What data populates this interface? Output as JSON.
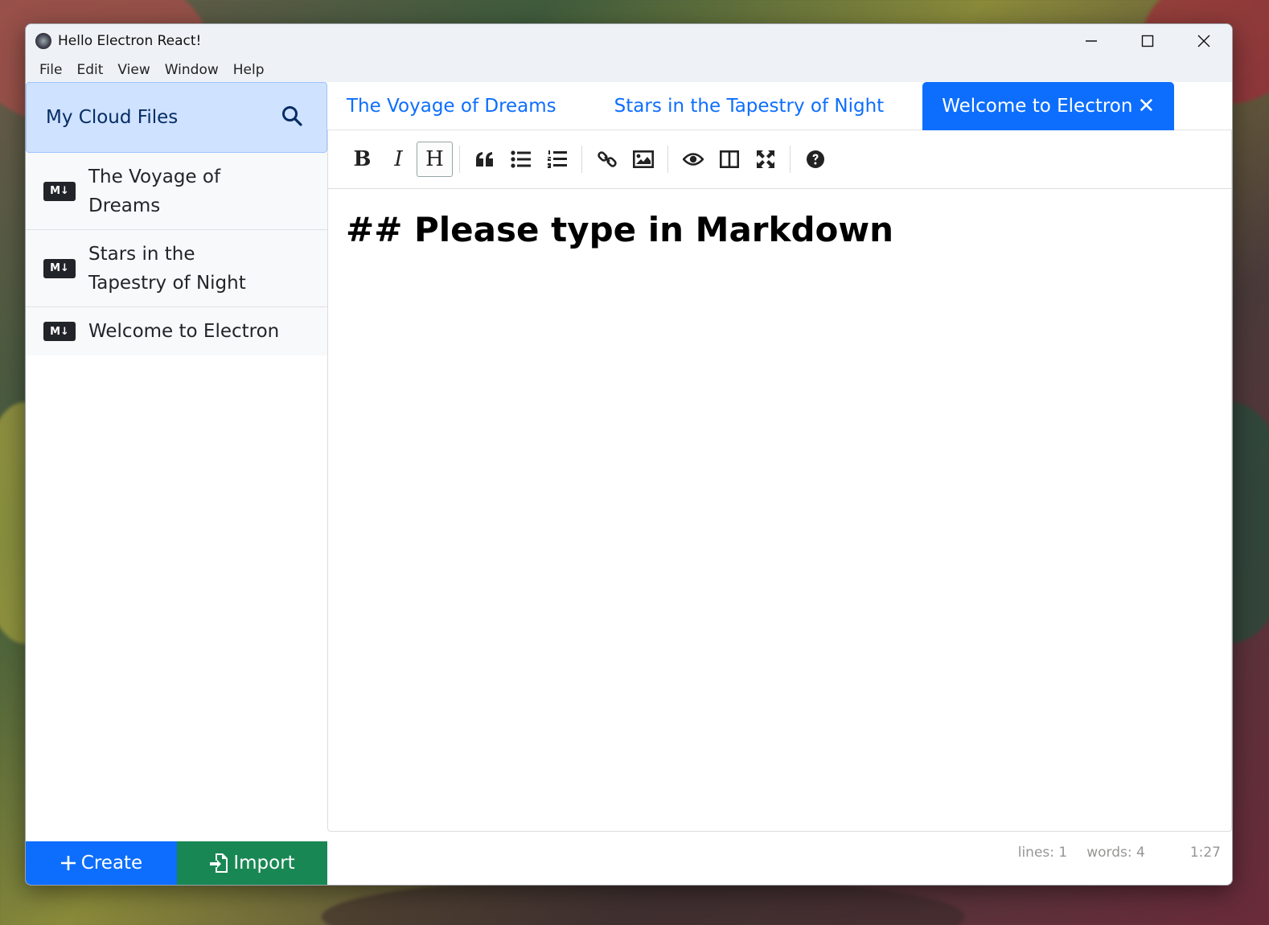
{
  "window": {
    "title": "Hello Electron React!"
  },
  "menu": [
    {
      "label": "File"
    },
    {
      "label": "Edit"
    },
    {
      "label": "View"
    },
    {
      "label": "Window"
    },
    {
      "label": "Help"
    }
  ],
  "sidebar": {
    "title": "My Cloud Files",
    "search_icon": "search-icon",
    "files": [
      {
        "badge": "M↓",
        "name": "The Voyage of Dreams"
      },
      {
        "badge": "M↓",
        "name": "Stars in the Tapestry of Night"
      },
      {
        "badge": "M↓",
        "name": "Welcome to Electron"
      }
    ],
    "create_label": "Create",
    "import_label": "Import"
  },
  "tabs": [
    {
      "label": "The Voyage of Dreams",
      "active": false
    },
    {
      "label": "Stars in the Tapestry of Night",
      "active": false
    },
    {
      "label": "Welcome to Electron",
      "active": true,
      "close": "✕"
    }
  ],
  "toolbar": {
    "bold": "B",
    "italic": "I",
    "heading": "H"
  },
  "editor": {
    "content": "## Please type in Markdown"
  },
  "status": {
    "lines": "lines: 1",
    "words": "words: 4",
    "cursor": "1:27"
  },
  "colors": {
    "primary": "#0d6efd",
    "success": "#198754",
    "sidebar_header": "#cfe2ff"
  }
}
